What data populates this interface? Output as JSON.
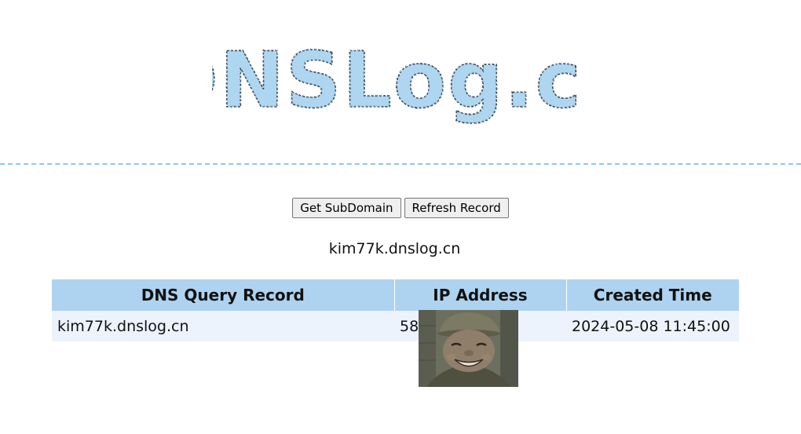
{
  "logo": {
    "text": "DNSLog.cn",
    "fill_color": "#aed6f1",
    "outline_color": "#3a4a58"
  },
  "toolbar": {
    "get_subdomain_label": "Get SubDomain",
    "refresh_record_label": "Refresh Record"
  },
  "subdomain": "kim77k.dnslog.cn",
  "table": {
    "headers": [
      "DNS Query Record",
      "IP Address",
      "Created Time"
    ],
    "rows": [
      {
        "query": "kim77k.dnslog.cn",
        "ip": "58",
        "time": "2024-05-08 11:45:00"
      }
    ]
  },
  "colors": {
    "header_bg": "#aed3f0",
    "row_bg": "#ecf3fd",
    "divider": "#8fc8e6"
  },
  "overlay_image": {
    "description_icon": "smiling-soldier-photo"
  }
}
